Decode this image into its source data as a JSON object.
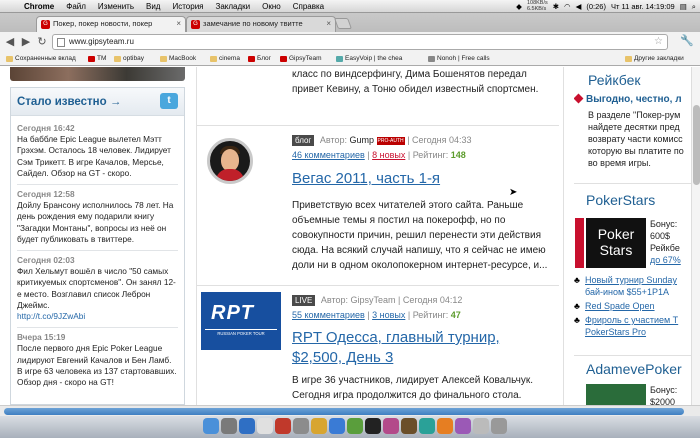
{
  "menubar": {
    "app": "Chrome",
    "items": [
      "Файл",
      "Изменить",
      "Вид",
      "История",
      "Закладки",
      "Окно",
      "Справка"
    ],
    "net_up": "108KB/s",
    "net_down": "6.5KB/s",
    "battery": "(0:26)",
    "clock": "Чт 11 авг.  14:19:09"
  },
  "tabs": [
    {
      "title": "Покер, покер новости, покер",
      "fav": "G"
    },
    {
      "title": "замечание по новому твитте",
      "fav": "G"
    }
  ],
  "toolbar": {
    "url": "www.gipsyteam.ru"
  },
  "bookmarks": {
    "items": [
      "Сохраненные вклад",
      "TM",
      "optibay",
      "MacBook",
      "cinema",
      "Блог",
      "GipsyTeam",
      "EasyVoip | the chea",
      "Nonoh | Free calls"
    ],
    "other": "Другие закладки"
  },
  "known": {
    "title": "Стало известно →",
    "items": [
      {
        "time": "Сегодня 16:42",
        "text": "На баббле Epic League вылетел Мэтт Грэхэм. Осталось 18 человек. Лидирует Сэм Трикетт. В игре Качалов, Мерсье, Сайдел. Обзор на GT - скоро."
      },
      {
        "time": "Сегодня 12:58",
        "text": "Дойлу Брансону исполнилось 78 лет. На день рождения ему подарили книгу \"Загадки Монтаны\", вопросы из неё он будет публиковать в твиттере."
      },
      {
        "time": "Сегодня 02:03",
        "text": "Фил Хельмут вошёл в число \"50 самых критикуемых спортсменов\". Он занял 12-е место. Возглавил список Леброн Джеймс.",
        "link": "http://t.co/9JZwAbi"
      },
      {
        "time": "Вчера 15:19",
        "text": "После первого дня Epic Poker League лидируют Евгений Качалов и Бен Ламб. В игре 63 человека из 137 стартовавших. Обзор дня - скоро на GT!"
      }
    ]
  },
  "intro": {
    "text": "класс по виндсерфингу, Дима Бошенятов передал привет Кевину, а Тоню обидел известный спортсмен."
  },
  "posts": [
    {
      "badge": "блог",
      "author_label": "Автор:",
      "author": "Gump",
      "author_badge": "PRO-AUTH",
      "time": "Сегодня 04:33",
      "comments": "46 комментариев",
      "new": "8 новых",
      "rating_label": "Рейтинг:",
      "rating": "148",
      "title": "Вегас 2011, часть 1-я",
      "body": "Приветствую всех читателей этого сайта. Раньше объемные темы я постил на покерофф, но по совокупности причин, решил перенести эти действия сюда. На всякий случай напишу, что я сейчас не имею доли ни в одном околопокерном интернет-ресурсе, и..."
    },
    {
      "badge": "LIVE",
      "author_label": "Автор:",
      "author": "GipsyTeam",
      "time": "Сегодня 04:12",
      "comments": "55 комментариев",
      "new": "3 новых",
      "rating_label": "Рейтинг:",
      "rating": "47",
      "logo_text": "RPT",
      "logo_sub": "RUSSIAN POKER TOUR",
      "title": "RPT Одесса, главный турнир, $2,500, День 3",
      "body": "В игре 36 участников, лидирует Алексей Ковальчук. Сегодня игра продолжится до финального стола."
    }
  ],
  "right": {
    "rakeback_title": "Рейкбек",
    "rakeback_head": "Выгодно, честно, л",
    "rakeback_body": [
      "В разделе \"Покер-рум",
      "найдете десятки пред",
      "возврату части комисс",
      "которую вы платите по",
      "во время игры."
    ],
    "ps_title": "PokerStars",
    "ps_logo_top": "Poker",
    "ps_logo_bottom": "Stars",
    "ps_side": [
      "Бонус:",
      "600$",
      "Рейкбе",
      "до 67%"
    ],
    "ps_links": [
      "Новый турнир Sunday",
      "бай-ином $55+1P1A",
      "Red Spade Open",
      "Фрироль с участием Т",
      "PokerStars Pro"
    ],
    "ap_title": "AdamevePoker",
    "ap_side": [
      "Бонус:",
      "$2000"
    ]
  }
}
